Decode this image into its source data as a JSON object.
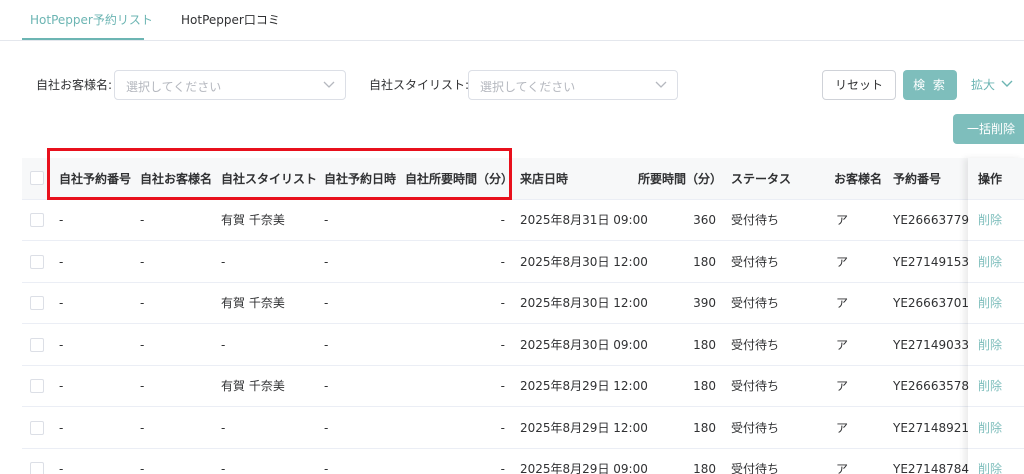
{
  "tabs": [
    {
      "label": "HotPepper予約リスト",
      "active": true
    },
    {
      "label": "HotPepper口コミ",
      "active": false
    }
  ],
  "filters": {
    "customer_label": "自社お客様名:",
    "customer_placeholder": "選択してください",
    "stylist_label": "自社スタイリスト:",
    "stylist_placeholder": "選択してください"
  },
  "buttons": {
    "reset": "リセット",
    "search": "検 索",
    "expand": "拡大",
    "bulk_delete": "一括削除"
  },
  "columns": [
    "自社予約番号",
    "自社お客様名",
    "自社スタイリスト",
    "自社予約日時",
    "自社所要時間（分）",
    "来店日時",
    "所要時間（分）",
    "ステータス",
    "お客様名",
    "予約番号",
    "操作"
  ],
  "rows": [
    {
      "own_no": "-",
      "own_customer": "-",
      "own_stylist": "有賀 千奈美",
      "own_datetime": "-",
      "own_duration": "-",
      "visit": "2025年8月31日 09:00",
      "duration": "360",
      "status": "受付待ち",
      "customer": "ア",
      "reservation_no": "YE26663779",
      "action": "削除"
    },
    {
      "own_no": "-",
      "own_customer": "-",
      "own_stylist": "-",
      "own_datetime": "-",
      "own_duration": "-",
      "visit": "2025年8月30日 12:00",
      "duration": "180",
      "status": "受付待ち",
      "customer": "ア",
      "reservation_no": "YE27149153",
      "action": "削除"
    },
    {
      "own_no": "-",
      "own_customer": "-",
      "own_stylist": "有賀 千奈美",
      "own_datetime": "-",
      "own_duration": "-",
      "visit": "2025年8月30日 12:00",
      "duration": "390",
      "status": "受付待ち",
      "customer": "ア",
      "reservation_no": "YE26663701",
      "action": "削除"
    },
    {
      "own_no": "-",
      "own_customer": "-",
      "own_stylist": "-",
      "own_datetime": "-",
      "own_duration": "-",
      "visit": "2025年8月30日 09:00",
      "duration": "180",
      "status": "受付待ち",
      "customer": "ア",
      "reservation_no": "YE27149033",
      "action": "削除"
    },
    {
      "own_no": "-",
      "own_customer": "-",
      "own_stylist": "有賀 千奈美",
      "own_datetime": "-",
      "own_duration": "-",
      "visit": "2025年8月29日 12:00",
      "duration": "180",
      "status": "受付待ち",
      "customer": "ア",
      "reservation_no": "YE26663578",
      "action": "削除"
    },
    {
      "own_no": "-",
      "own_customer": "-",
      "own_stylist": "-",
      "own_datetime": "-",
      "own_duration": "-",
      "visit": "2025年8月29日 12:00",
      "duration": "180",
      "status": "受付待ち",
      "customer": "ア",
      "reservation_no": "YE27148921",
      "action": "削除"
    },
    {
      "own_no": "-",
      "own_customer": "-",
      "own_stylist": "-",
      "own_datetime": "-",
      "own_duration": "-",
      "visit": "2025年8月29日 09:00",
      "duration": "180",
      "status": "受付待ち",
      "customer": "ア",
      "reservation_no": "YE27148784",
      "action": "削除"
    }
  ],
  "colors": {
    "accent": "#6cb5b3",
    "button": "#7ebebc",
    "highlight": "#e8101c"
  },
  "icons": [
    "chevron-down-icon",
    "checkbox-icon"
  ]
}
